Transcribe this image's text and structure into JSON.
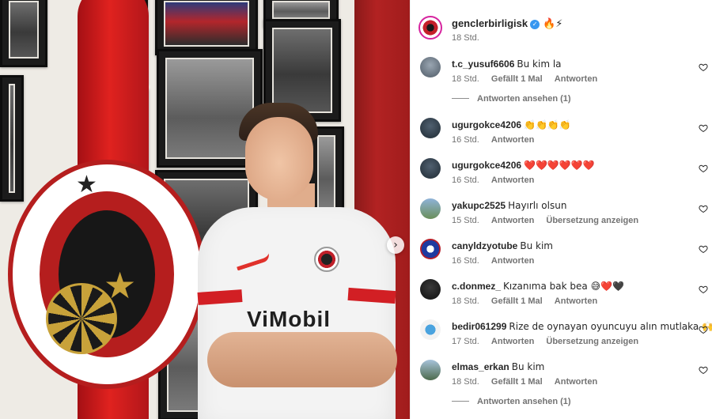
{
  "post": {
    "owner": "genclerbirligisk",
    "owner_caption": "🔥⚡",
    "owner_time": "18 Std."
  },
  "photo": {
    "sponsor_text": "ViMobil"
  },
  "comments": [
    {
      "user": "t.c_yusuf6606",
      "text": "Bu kim la",
      "time": "18 Std.",
      "likes": "Gefällt 1 Mal",
      "reply": "Antworten"
    },
    {
      "user": "ugurgokce4206",
      "text": "👏👏👏👏",
      "time": "16 Std.",
      "reply": "Antworten"
    },
    {
      "user": "ugurgokce4206",
      "text": "❤️❤️❤️❤️❤️❤️",
      "time": "16 Std.",
      "reply": "Antworten"
    },
    {
      "user": "yakupc2525",
      "text": "Hayırlı olsun",
      "time": "15 Std.",
      "reply": "Antworten",
      "translate": "Übersetzung anzeigen"
    },
    {
      "user": "canyldzyotube",
      "text": "Bu kim",
      "time": "16 Std.",
      "reply": "Antworten"
    },
    {
      "user": "c.donmez_",
      "text": "Kızanıma bak bea 😅❤️🖤",
      "time": "18 Std.",
      "likes": "Gefällt 1 Mal",
      "reply": "Antworten"
    },
    {
      "user": "bedir061299",
      "text": "Rize de oynayan oyuncuyu alın mutlaka 🙌",
      "time": "17 Std.",
      "reply": "Antworten",
      "translate": "Übersetzung anzeigen"
    },
    {
      "user": "elmas_erkan",
      "text": "Bu kim",
      "time": "18 Std.",
      "likes": "Gefällt 1 Mal",
      "reply": "Antworten"
    }
  ],
  "view_replies_1": "Antworten ansehen (1)",
  "view_replies_2": "Antworten ansehen (1)",
  "icons": {
    "carousel_next": "chevron-right-icon",
    "like": "heart-icon",
    "verified": "verified-badge-icon"
  },
  "colors": {
    "verified": "#3897f0",
    "meta": "#737373",
    "club_red": "#c4202a"
  }
}
